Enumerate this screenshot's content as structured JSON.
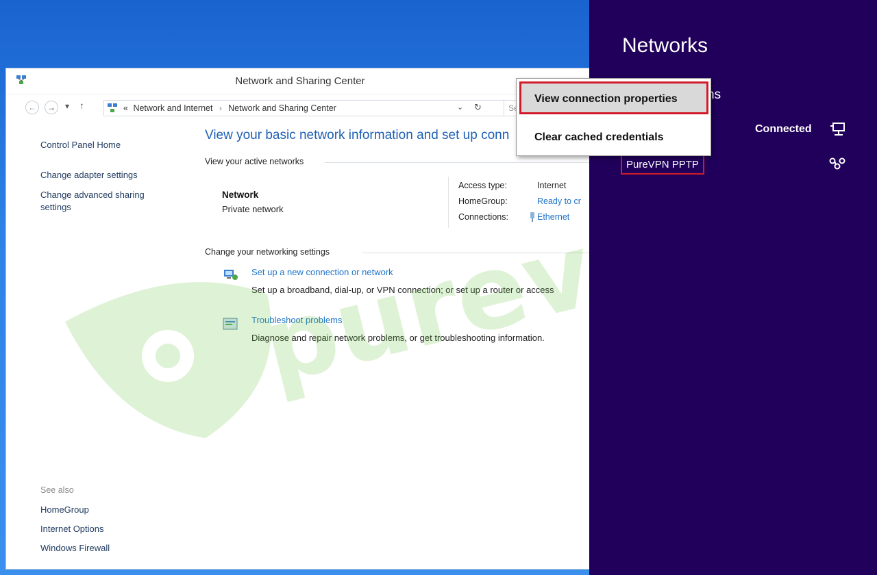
{
  "window": {
    "title": "Network and Sharing Center"
  },
  "navigation": {
    "back_icon": "back-arrow-icon",
    "forward_icon": "forward-arrow-icon",
    "history_glyph": "▾",
    "up_glyph": "↑",
    "breadcrumb": {
      "prefix": "«",
      "items": [
        "Network and Internet",
        "Network and Sharing Center"
      ],
      "separator": "›"
    },
    "dropdown_glyph": "⌄",
    "refresh_glyph": "↻",
    "search_placeholder": "Se"
  },
  "left_pane": {
    "links": [
      "Control Panel Home",
      "Change adapter settings",
      "Change advanced sharing",
      "settings"
    ],
    "see_also_label": "See also",
    "see_also": [
      "HomeGroup",
      "Internet Options",
      "Windows Firewall"
    ]
  },
  "main": {
    "heading": "View your basic network information and set up conn",
    "active_networks_label": "View your active networks",
    "network": {
      "name": "Network",
      "type": "Private network"
    },
    "details": [
      {
        "key": "Access type:",
        "value": "Internet",
        "link": false
      },
      {
        "key": "HomeGroup:",
        "value": "Ready to cr",
        "link": true
      },
      {
        "key": "Connections:",
        "value": "Ethernet",
        "link": true
      }
    ],
    "change_settings_label": "Change your networking settings",
    "settings": [
      {
        "link": "Set up a new connection or network",
        "desc": "Set up a broadband, dial-up, or VPN connection; or set up a router or access",
        "icon": "network-setup-icon"
      },
      {
        "link": "Troubleshoot problems",
        "desc": "Diagnose and repair network problems, or get troubleshooting information.",
        "icon": "troubleshoot-icon"
      }
    ]
  },
  "charm": {
    "title": "Networks",
    "section_fragment": "ns",
    "status": "Connected",
    "vpn_name": "PureVPN PPTP",
    "colors": {
      "background": "#20005a",
      "highlight": "#d11b2a"
    }
  },
  "context_menu": {
    "items": [
      "View connection properties",
      "Clear cached credentials"
    ]
  },
  "watermark": {
    "text": "purevpn"
  }
}
